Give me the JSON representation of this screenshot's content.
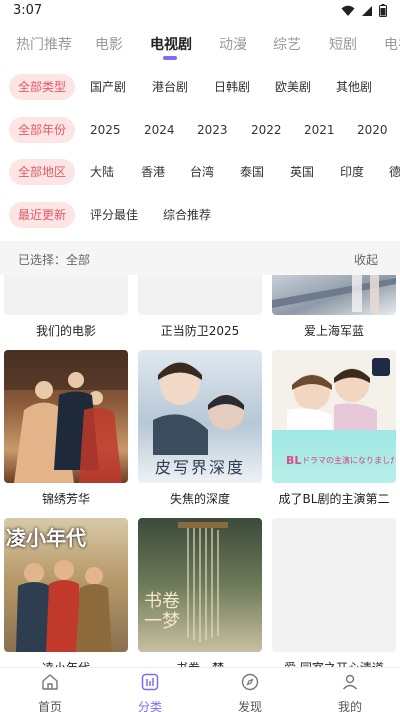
{
  "status_bar": {
    "time": "3:07"
  },
  "tabs": [
    {
      "label": "热门推荐"
    },
    {
      "label": "电影"
    },
    {
      "label": "电视剧",
      "active": true
    },
    {
      "label": "动漫"
    },
    {
      "label": "综艺"
    },
    {
      "label": "短剧"
    },
    {
      "label": "电视"
    }
  ],
  "filters": {
    "type": [
      "全部类型",
      "国产剧",
      "港台剧",
      "日韩剧",
      "欧美剧",
      "其他剧"
    ],
    "year": [
      "全部年份",
      "2025",
      "2024",
      "2023",
      "2022",
      "2021",
      "2020"
    ],
    "region": [
      "全部地区",
      "大陆",
      "香港",
      "台湾",
      "泰国",
      "英国",
      "印度",
      "德"
    ],
    "sort": [
      "最近更新",
      "评分最佳",
      "综合推荐"
    ]
  },
  "selection": {
    "label": "已选择：全部",
    "collapse": "收起"
  },
  "items": [
    {
      "title": "我们的电影"
    },
    {
      "title": "正当防卫2025"
    },
    {
      "title": "爱上海军蓝"
    },
    {
      "title": "锦绣芳华"
    },
    {
      "title": "失焦的深度"
    },
    {
      "title": "成了BL剧的主演第二"
    },
    {
      "title": "凌小年代"
    },
    {
      "title": "书卷一梦"
    },
    {
      "title": "爱 同室之开心清道"
    }
  ],
  "poster_texts": {
    "poster5": "皮写界深度",
    "poster6_badge": "BL",
    "poster6_sub": "ドラマの主演になりました",
    "poster7": "凌小年代",
    "poster8": "书卷一梦"
  },
  "nav": [
    {
      "label": "首页",
      "icon": "home-icon"
    },
    {
      "label": "分类",
      "icon": "category-icon",
      "active": true
    },
    {
      "label": "发现",
      "icon": "compass-icon"
    },
    {
      "label": "我的",
      "icon": "user-icon"
    }
  ],
  "colors": {
    "accent": "#7b6cf6",
    "chip_bg": "#fde5e6",
    "chip_text": "#e45a63"
  }
}
